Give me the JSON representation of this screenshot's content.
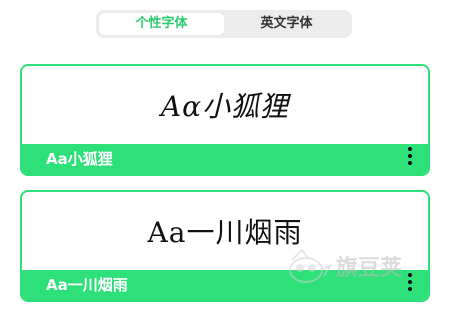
{
  "tabs": [
    {
      "label": "个性字体",
      "active": true
    },
    {
      "label": "英文字体",
      "active": false
    }
  ],
  "fonts": [
    {
      "preview": "Aα小狐狸",
      "name": "Aa小狐狸"
    },
    {
      "preview": "Aa一川烟雨",
      "name": "Aa一川烟雨"
    }
  ],
  "watermark": {
    "text": "旗豆荚"
  },
  "colors": {
    "accent": "#2ee07a",
    "active_tab_text": "#2ecc71",
    "segment_bg": "#ececec"
  },
  "icons": {
    "more": "vertical-ellipsis-icon",
    "watermark_logo": "bird-logo-icon"
  }
}
